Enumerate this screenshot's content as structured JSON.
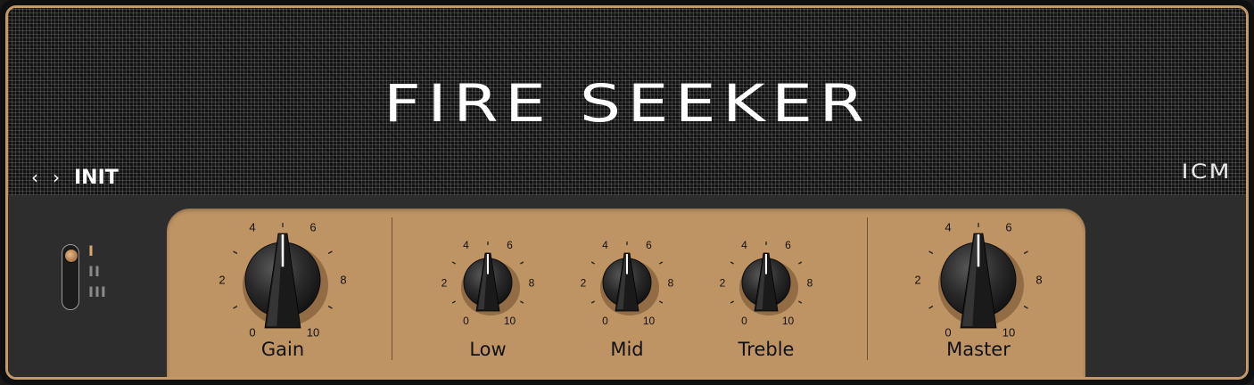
{
  "title": "FIRE SEEKER",
  "preset": {
    "prev_icon": "chevron-left-icon",
    "next_icon": "chevron-right-icon",
    "prev_glyph": "‹",
    "next_glyph": "›",
    "name": "INIT"
  },
  "brand": "ICM",
  "switch": {
    "labels": [
      "I",
      "II",
      "III"
    ],
    "selected": 0
  },
  "scale_labels": [
    "0",
    "2",
    "4",
    "6",
    "8",
    "10"
  ],
  "knobs": [
    {
      "label": "Gain",
      "value": 5.0
    },
    {
      "label": "Low",
      "value": 5.0
    },
    {
      "label": "Mid",
      "value": 5.0
    },
    {
      "label": "Treble",
      "value": 5.0
    },
    {
      "label": "Master",
      "value": 5.0
    }
  ],
  "colors": {
    "panel": "#bf9465",
    "trim": "#c4996a",
    "accent_active": "#d9a86f",
    "inactive": "#8a8a8a"
  }
}
